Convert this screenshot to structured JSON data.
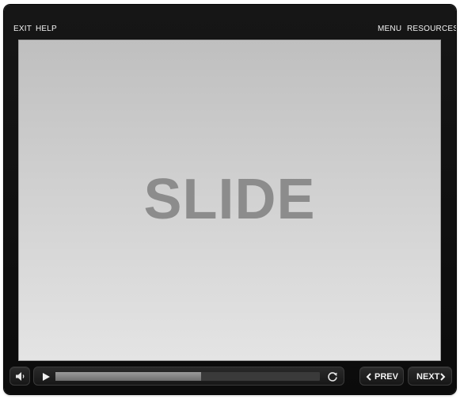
{
  "topbar": {
    "exit_label": "EXIT",
    "help_label": "HELP",
    "menu_label": "MENU",
    "resources_label": "RESOURCES"
  },
  "slide": {
    "text": "SLIDE"
  },
  "controls": {
    "progress_fraction": 0.55,
    "prev_label": "PREV",
    "next_label": "NEXT"
  },
  "icons": {
    "volume": "volume-icon",
    "play": "play-icon",
    "replay": "replay-icon",
    "prev": "chevron-left-icon",
    "next": "chevron-right-icon"
  },
  "colors": {
    "frame": "#111111",
    "slide_text": "#8c8c8c",
    "progress_fill": "#8a8a8a"
  }
}
